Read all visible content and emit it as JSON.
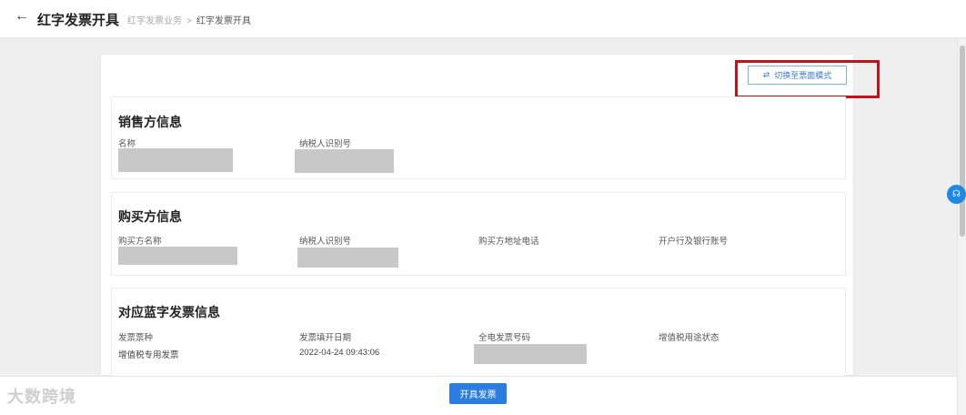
{
  "header": {
    "back_icon": "←",
    "title": "红字发票开具",
    "breadcrumb": [
      "红字发票业务",
      "红字发票开具"
    ],
    "breadcrumb_separator": ">"
  },
  "toolbar": {
    "switch_icon": "⇄",
    "switch_label": "切换至票面模式"
  },
  "seller": {
    "title": "销售方信息",
    "fields": [
      {
        "label": "名称",
        "value": ""
      },
      {
        "label": "纳税人识别号",
        "value": ""
      }
    ]
  },
  "buyer": {
    "title": "购买方信息",
    "fields": [
      {
        "label": "购买方名称",
        "value": ""
      },
      {
        "label": "纳税人识别号",
        "value": ""
      },
      {
        "label": "购买方地址电话",
        "value": ""
      },
      {
        "label": "开户行及银行账号",
        "value": ""
      }
    ]
  },
  "blue_invoice": {
    "title": "对应蓝字发票信息",
    "fields": [
      {
        "label": "发票票种",
        "value": "增值税专用发票"
      },
      {
        "label": "发票填开日期",
        "value": "2022-04-24 09:43:06"
      },
      {
        "label": "全电发票号码",
        "value": ""
      },
      {
        "label": "增值税用途状态",
        "value": ""
      }
    ]
  },
  "footer": {
    "issue_button": "开具发票"
  },
  "help_icon": "☊",
  "watermark": "大数跨境",
  "colors": {
    "accent": "#2b7de0",
    "highlight_box": "#c8101a",
    "redaction": "#c8c8c8"
  }
}
